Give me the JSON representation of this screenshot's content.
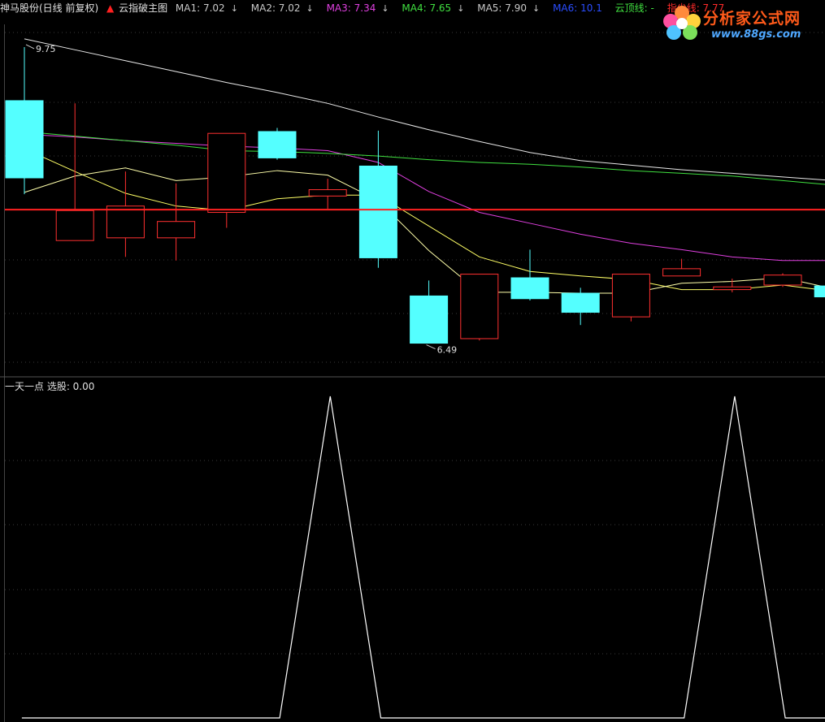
{
  "header": {
    "stock": "神马股份(日线 前复权)",
    "formula_name": "云指破主图",
    "ma_items": [
      {
        "label": "MA1: 7.02",
        "color": "#c8c8c8",
        "arrow": "↓"
      },
      {
        "label": "MA2: 7.02",
        "color": "#c8c8c8",
        "arrow": "↓"
      },
      {
        "label": "MA3: 7.34",
        "color": "#e040e0",
        "arrow": "↓"
      },
      {
        "label": "MA4: 7.65",
        "color": "#40e040",
        "arrow": "↓"
      },
      {
        "label": "MA5: 7.90",
        "color": "#c8c8c8",
        "arrow": "↓"
      },
      {
        "label": "MA6: 10.1",
        "color": "#2a4dff",
        "arrow": ""
      },
      {
        "label": "云顶线: -",
        "color": "#40e040",
        "arrow": ""
      },
      {
        "label": "指尖线: 7.77",
        "color": "#ff2a2a",
        "arrow": ""
      }
    ],
    "icon": "red-up-arrow-icon"
  },
  "logo": {
    "title": "分析家公式网",
    "url": "www.88gs.com"
  },
  "sub_header": {
    "text": "一天一点 选股: 0.00"
  },
  "chart_data": [
    {
      "type": "candlestick",
      "ylim": [
        6.2,
        10.0
      ],
      "high_label": "9.75",
      "low_label": "6.49",
      "candles": [
        {
          "o": 8.31,
          "c": 9.16,
          "h": 9.75,
          "l": 8.13,
          "up": false
        },
        {
          "o": 7.62,
          "c": 7.95,
          "h": 9.13,
          "l": 7.62,
          "up": true
        },
        {
          "o": 7.65,
          "c": 8.0,
          "h": 8.38,
          "l": 7.44,
          "up": true
        },
        {
          "o": 7.65,
          "c": 7.83,
          "h": 8.25,
          "l": 7.4,
          "up": true
        },
        {
          "o": 7.93,
          "c": 8.8,
          "h": 8.8,
          "l": 7.76,
          "up": true
        },
        {
          "o": 8.53,
          "c": 8.82,
          "h": 8.86,
          "l": 8.51,
          "up": false
        },
        {
          "o": 8.11,
          "c": 8.18,
          "h": 8.3,
          "l": 7.97,
          "up": true
        },
        {
          "o": 8.44,
          "c": 7.43,
          "h": 8.83,
          "l": 7.32,
          "up": false
        },
        {
          "o": 6.49,
          "c": 7.01,
          "h": 7.18,
          "l": 6.49,
          "up": false
        },
        {
          "o": 6.54,
          "c": 7.25,
          "h": 7.25,
          "l": 6.52,
          "up": true
        },
        {
          "o": 6.98,
          "c": 7.21,
          "h": 7.52,
          "l": 6.96,
          "up": false
        },
        {
          "o": 6.83,
          "c": 7.04,
          "h": 7.1,
          "l": 6.69,
          "up": false
        },
        {
          "o": 6.78,
          "c": 7.25,
          "h": 7.25,
          "l": 6.73,
          "up": true
        },
        {
          "o": 7.23,
          "c": 7.31,
          "h": 7.42,
          "l": 7.23,
          "up": true
        },
        {
          "o": 7.08,
          "c": 7.11,
          "h": 7.2,
          "l": 7.05,
          "up": true
        },
        {
          "o": 7.13,
          "c": 7.24,
          "h": 7.26,
          "l": 7.11,
          "up": true
        },
        {
          "o": 7.0,
          "c": 7.12,
          "h": 7.18,
          "l": 6.99,
          "up": false
        }
      ],
      "series": [
        {
          "color": "#ffff66",
          "values": [
            8.63,
            8.38,
            8.14,
            8.0,
            7.95,
            8.08,
            8.12,
            8.12,
            7.78,
            7.44,
            7.28,
            7.23,
            7.19,
            7.08,
            7.08,
            7.13,
            7.06
          ]
        },
        {
          "color": "#ffffaa",
          "values": [
            8.15,
            8.33,
            8.42,
            8.28,
            8.32,
            8.39,
            8.34,
            8.06,
            7.51,
            7.05,
            7.05,
            7.04,
            7.04,
            7.15,
            7.17,
            7.21,
            7.09
          ]
        },
        {
          "color": "#e040e0",
          "values": [
            8.79,
            8.76,
            8.72,
            8.69,
            8.66,
            8.64,
            8.61,
            8.48,
            8.16,
            7.93,
            7.81,
            7.69,
            7.59,
            7.52,
            7.44,
            7.4,
            7.4
          ]
        },
        {
          "color": "#40e040",
          "values": [
            8.82,
            8.77,
            8.72,
            8.67,
            8.61,
            8.6,
            8.58,
            8.55,
            8.51,
            8.48,
            8.46,
            8.43,
            8.39,
            8.36,
            8.33,
            8.28,
            8.23
          ]
        },
        {
          "color": "#e8e8e8",
          "values": [
            9.84,
            9.72,
            9.6,
            9.48,
            9.36,
            9.25,
            9.13,
            8.98,
            8.84,
            8.71,
            8.59,
            8.5,
            8.45,
            8.4,
            8.36,
            8.32,
            8.28
          ]
        }
      ],
      "hline": {
        "value": 7.96,
        "color": "#ff2020"
      }
    },
    {
      "type": "line",
      "ylim": [
        0,
        1
      ],
      "series": [
        {
          "color": "#ffffff",
          "points": [
            [
              -0.05,
              0
            ],
            [
              5.05,
              0
            ],
            [
              6.05,
              1
            ],
            [
              7.05,
              0
            ],
            [
              13.05,
              0
            ],
            [
              14.05,
              1
            ],
            [
              15.05,
              0
            ],
            [
              16.5,
              0
            ]
          ]
        }
      ]
    }
  ]
}
